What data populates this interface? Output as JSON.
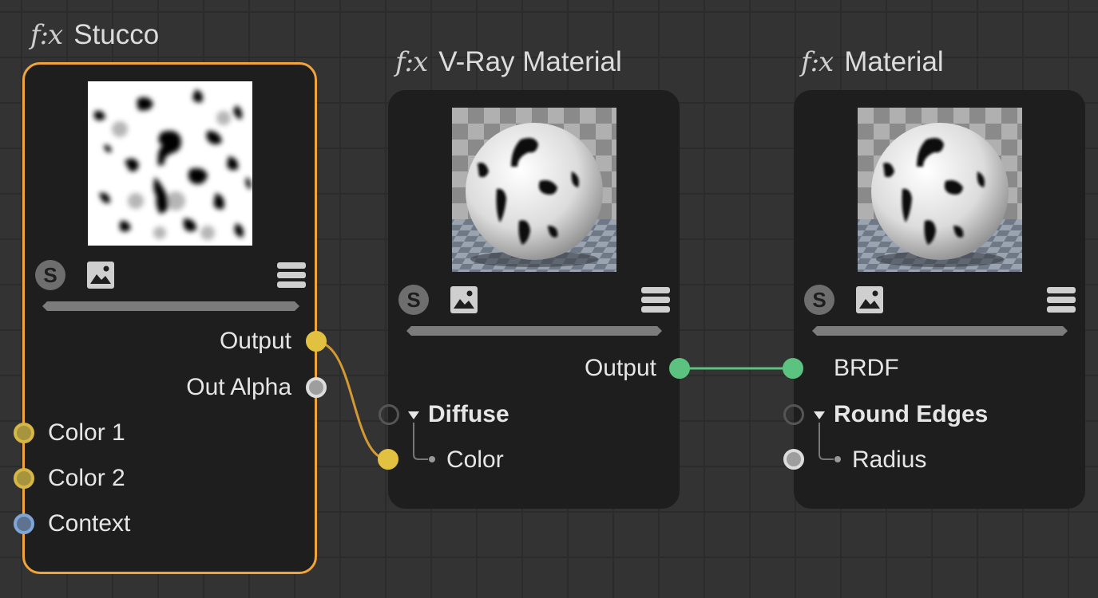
{
  "nodes": {
    "stucco": {
      "fx": "f:x",
      "title": "Stucco",
      "outputs": [
        "Output",
        "Out Alpha"
      ],
      "inputs": [
        "Color 1",
        "Color 2",
        "Context"
      ],
      "icons": [
        "s-icon",
        "image-icon",
        "menu-icon"
      ]
    },
    "vray": {
      "fx": "f:x",
      "title": "V-Ray Material",
      "output": "Output",
      "group": "Diffuse",
      "group_child": "Color",
      "icons": [
        "s-icon",
        "image-icon",
        "menu-icon"
      ]
    },
    "material": {
      "fx": "f:x",
      "title": "Material",
      "input": "BRDF",
      "group": "Round Edges",
      "group_child": "Radius",
      "icons": [
        "s-icon",
        "image-icon",
        "menu-icon"
      ]
    }
  },
  "colors": {
    "background": "#333333",
    "grid": "#2b2b2b",
    "node_body": "#1e1e1e",
    "selection": "#f0a43a",
    "wire_color": "#d39a33",
    "wire_shader": "#5cc27f",
    "port_yellow": "#e2c140",
    "port_blue": "#7fa6d8",
    "port_green": "#5cc27f"
  }
}
